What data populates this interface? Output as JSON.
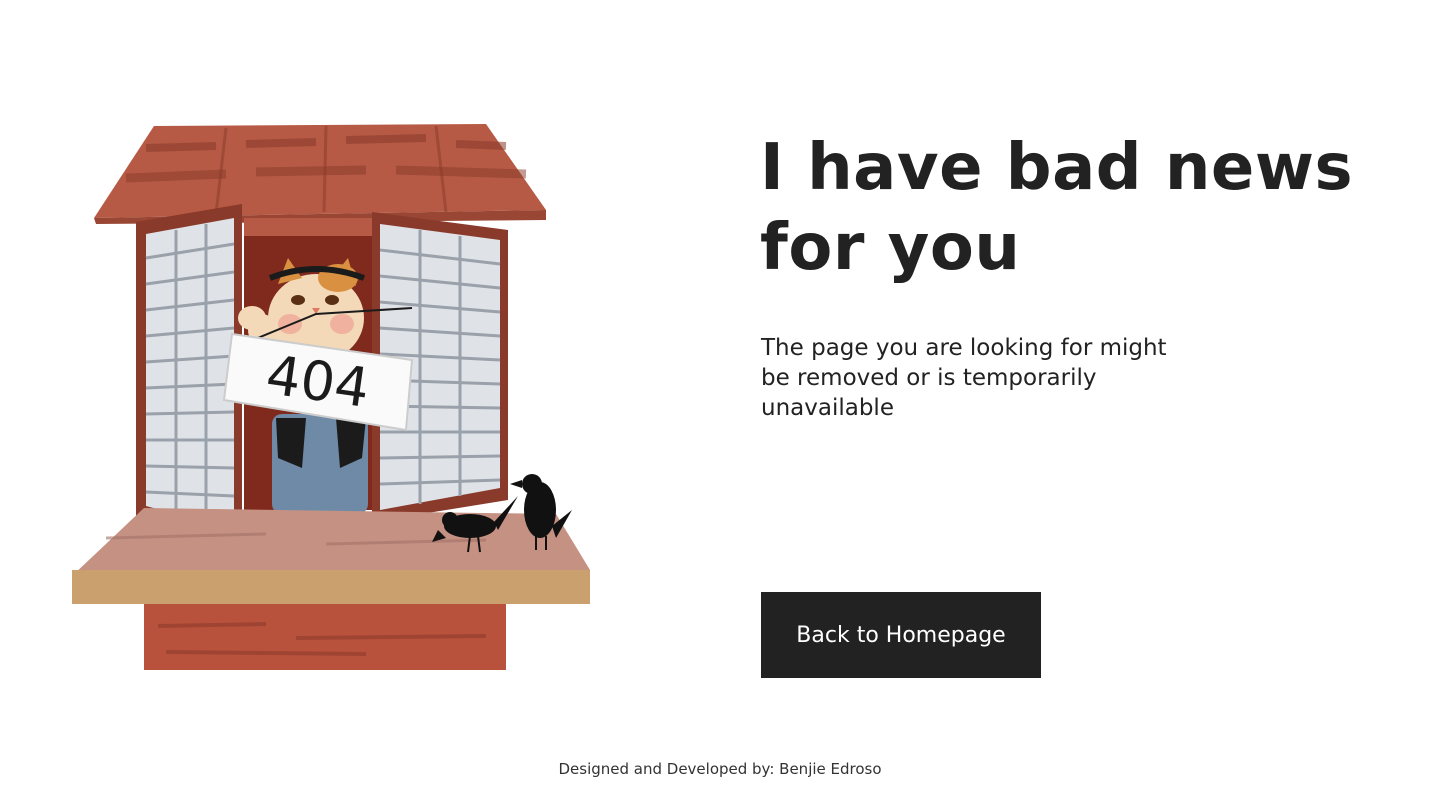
{
  "illustration": {
    "sign_text": "404"
  },
  "main": {
    "heading": "I have bad news for you",
    "description": "The page you are looking for might be removed or is temporarily unavailable",
    "home_button_label": "Back to Homepage"
  },
  "footer": {
    "credit": "Designed and Developed by: Benjie Edroso"
  },
  "colors": {
    "background": "#ffffff",
    "text": "#222222",
    "button_bg": "#222222",
    "button_text": "#ffffff"
  }
}
